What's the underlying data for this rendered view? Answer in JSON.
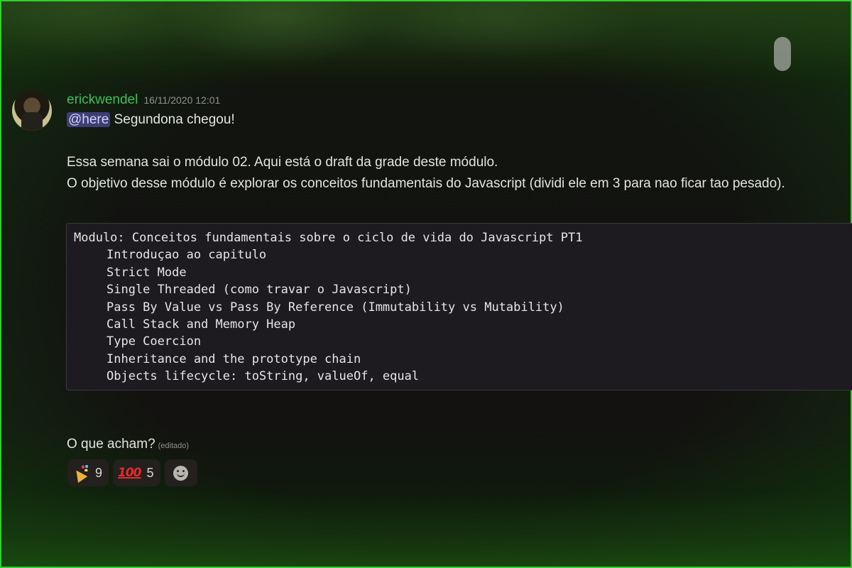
{
  "message": {
    "username": "erickwendel",
    "timestamp": "16/11/2020 12:01",
    "mention": "@here",
    "first_line_text": " Segundona chegou!",
    "paragraph_lines": [
      "Essa semana sai o módulo 02. Aqui está o draft da grade deste módulo.",
      "O objetivo desse módulo é explorar os conceitos fundamentais do Javascript (dividi ele em 3 para nao ficar tao pesado)."
    ],
    "code_title": "Modulo: Conceitos fundamentais sobre o ciclo de vida do Javascript PT1",
    "code_items": [
      "Introduçao ao capitulo",
      "Strict Mode",
      "Single Threaded (como travar o Javascript)",
      "Pass By Value vs Pass By Reference (Immutability vs Mutability)",
      "Call Stack and Memory Heap",
      "Type Coercion",
      "Inheritance and the prototype chain",
      "Objects lifecycle: toString, valueOf, equal"
    ],
    "closing_text": "O que acham?",
    "edited_label": "(editado)"
  },
  "reactions": [
    {
      "emoji": "party-popper-icon",
      "count": "9"
    },
    {
      "emoji": "hundred-points-icon",
      "symbol": "100",
      "count": "5"
    }
  ],
  "add_reaction": {
    "icon": "smiley-add-reaction-icon"
  },
  "colors": {
    "username": "#3fbf58",
    "mention_bg": "#3c3f72",
    "frame_border": "#2fd12a",
    "code_bg": "#1d1b1f"
  }
}
